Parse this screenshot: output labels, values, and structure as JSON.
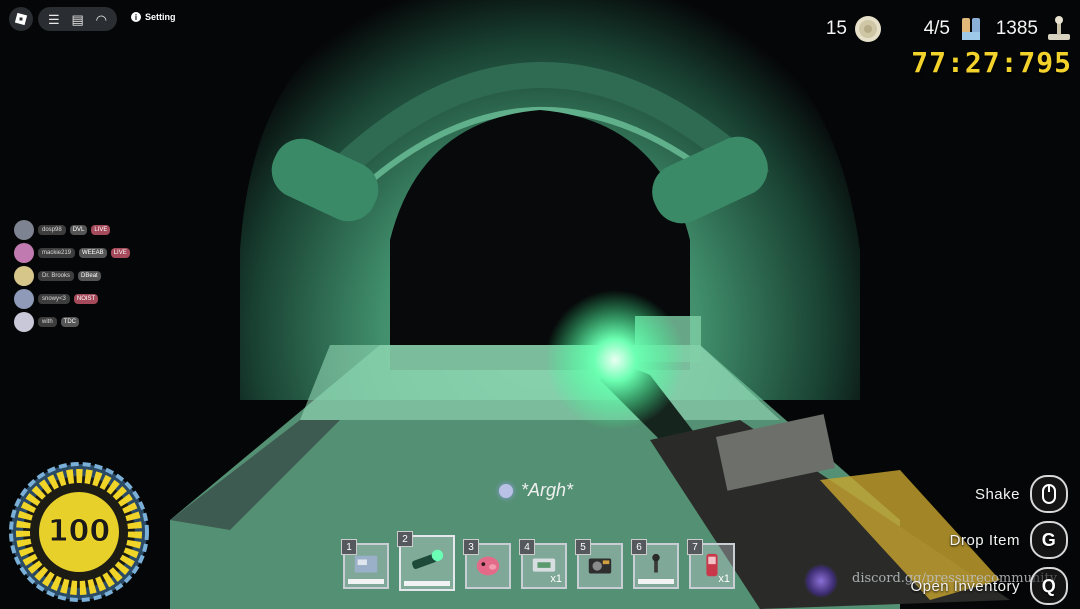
{
  "topbar": {
    "menu_icon": "hamburger-icon",
    "chat_icon": "chat-icon",
    "voice_icon": "headset-icon",
    "setting_label": "Setting"
  },
  "stats": {
    "coins": "15",
    "batteries": "4/5",
    "score": "1385",
    "timer": "77:27:795"
  },
  "players": [
    {
      "name": "dosp98",
      "tag": "DVL",
      "badge": "LIVE"
    },
    {
      "name": "mackie219",
      "tag": "WEEAB",
      "badge": "LIVE"
    },
    {
      "name": "Dr. Brooks",
      "tag": "DBeat",
      "badge": ""
    },
    {
      "name": "snowy<3",
      "tag": "NOIST",
      "badge": ""
    },
    {
      "name": "with",
      "tag": "TDC",
      "badge": ""
    }
  ],
  "health": {
    "value": "100"
  },
  "chat_bubble": "*Argh*",
  "hotbar": [
    {
      "num": "1",
      "item": "map",
      "count": ""
    },
    {
      "num": "2",
      "item": "flashlight",
      "count": ""
    },
    {
      "num": "3",
      "item": "pink-piggy-bank",
      "count": ""
    },
    {
      "num": "4",
      "item": "medkit",
      "count": "x1"
    },
    {
      "num": "5",
      "item": "camera",
      "count": ""
    },
    {
      "num": "6",
      "item": "key",
      "count": ""
    },
    {
      "num": "7",
      "item": "phone",
      "count": "x1"
    }
  ],
  "hints": [
    {
      "label": "Shake",
      "key": ""
    },
    {
      "label": "Drop Item",
      "key": "G"
    },
    {
      "label": "Open Inventory",
      "key": "Q"
    }
  ],
  "watermark": "discord.gg/pressurecommunity"
}
